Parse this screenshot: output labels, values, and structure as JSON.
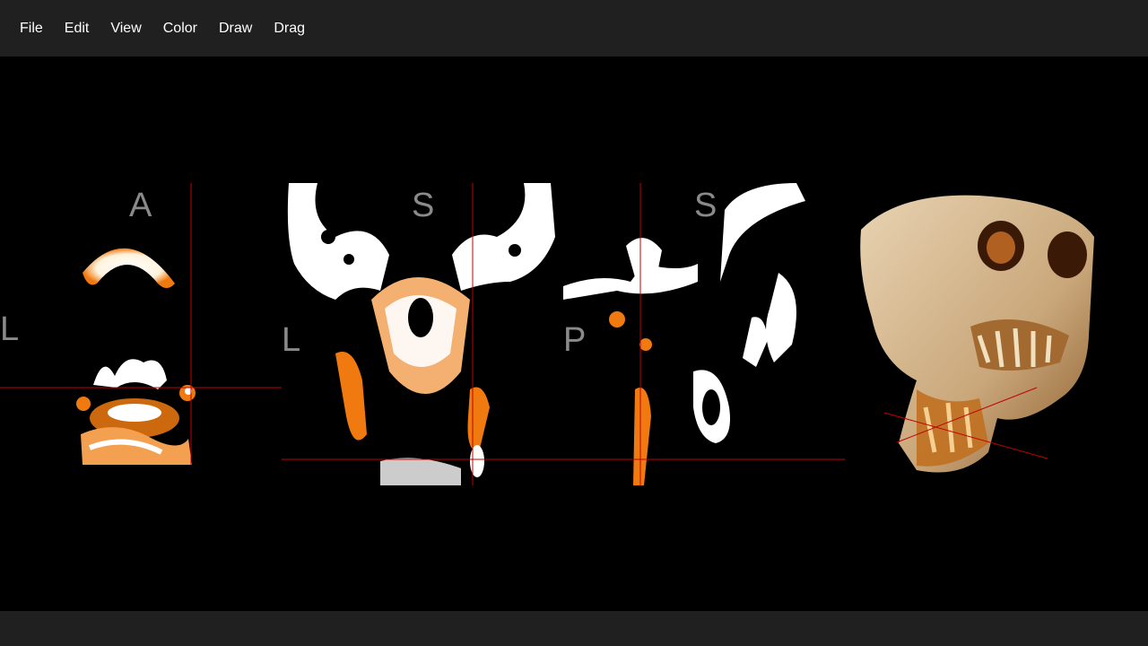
{
  "menu": {
    "items": [
      "File",
      "Edit",
      "View",
      "Color",
      "Draw",
      "Drag"
    ]
  },
  "viewer": {
    "axial": {
      "top_label": "A",
      "left_label": "L"
    },
    "coronal": {
      "top_label": "S",
      "left_label": "L"
    },
    "sagittal": {
      "top_label": "S",
      "left_label": "P"
    },
    "render3d": {}
  },
  "status": {
    "text": ""
  },
  "colors": {
    "background": "#000000",
    "bar": "#202020",
    "crosshair": "#c00000",
    "orientation_label": "#8a8a8a",
    "bone_bright": "#ffffff",
    "bone_orange": "#f07a10"
  }
}
